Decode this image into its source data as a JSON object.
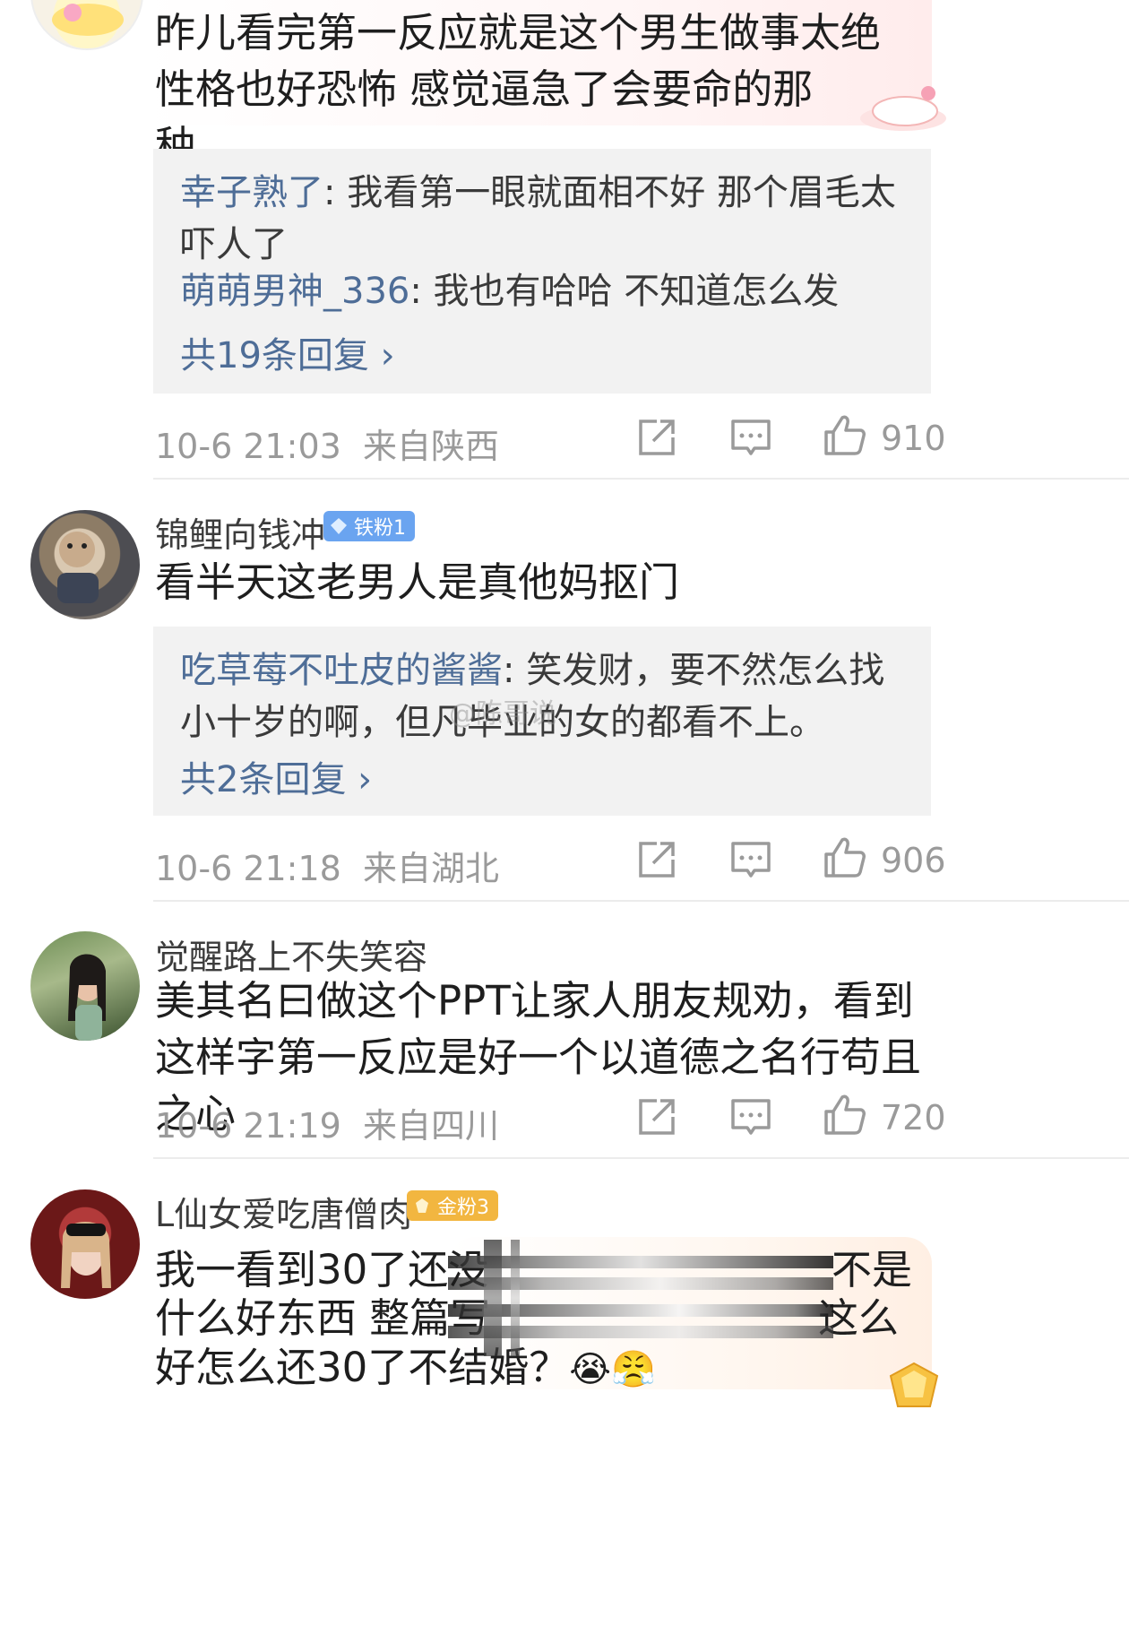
{
  "watermark": "@陈哥说",
  "comments": [
    {
      "text": "昨儿看完第一反应就是这个男生做事太绝 性格也好恐怖 感觉逼急了会要命的那种……",
      "replies": [
        {
          "author": "幸子熟了",
          "text": ": 我看第一眼就面相不好 那个眉毛太吓人了"
        },
        {
          "author": "萌萌男神_336",
          "text": ": 我也有哈哈 不知道怎么发"
        }
      ],
      "reply_more": "共19条回复 ›",
      "time": "10-6 21:03",
      "location": "来自陕西",
      "likes": "910"
    },
    {
      "username": "锦鲤向钱冲",
      "badge": "铁粉1",
      "text": "看半天这老男人是真他妈抠门",
      "replies": [
        {
          "author": "吃草莓不吐皮的酱酱",
          "text": ": 笑发财，要不然怎么找小十岁的啊，但凡毕业的女的都看不上。"
        }
      ],
      "reply_more": "共2条回复 ›",
      "time": "10-6 21:18",
      "location": "来自湖北",
      "likes": "906"
    },
    {
      "username": "觉醒路上不失笑容",
      "text": "美其名曰做这个PPT让家人朋友规劝，看到这样字第一反应是好一个以道德之名行苟且之心",
      "time": "10-6 21:19",
      "location": "来自四川",
      "likes": "720"
    },
    {
      "username": "L仙女爱吃唐僧肉",
      "badge": "金粉3",
      "text_line1_a": "我一看到30了还没",
      "text_line1_b": "不是",
      "text_line2_a": "什么好东西 整篇写",
      "text_line2_b": "这么",
      "text_line3": "好怎么还30了不结婚？",
      "emoji": "😭😤"
    }
  ],
  "colors": {
    "link": "#4e6d97",
    "meta": "#9a9a9a",
    "reply_bg": "#f2f2f2",
    "badge_iron": "#6aa4f0",
    "badge_gold": "#f2b640"
  }
}
